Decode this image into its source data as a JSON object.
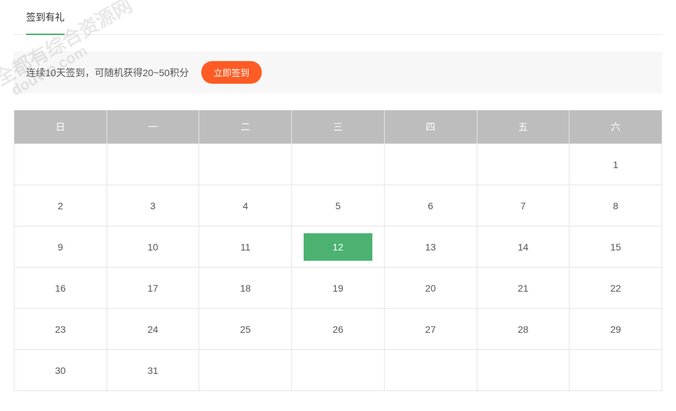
{
  "tabs": [
    {
      "label": "签到有礼",
      "active": true
    }
  ],
  "info": {
    "text": "连续10天签到，可随机获得20~50积分",
    "button": "立即签到"
  },
  "calendar": {
    "headers": [
      "日",
      "一",
      "二",
      "三",
      "四",
      "五",
      "六"
    ],
    "today": 12,
    "weeks": [
      [
        "",
        "",
        "",
        "",
        "",
        "",
        "1"
      ],
      [
        "2",
        "3",
        "4",
        "5",
        "6",
        "7",
        "8"
      ],
      [
        "9",
        "10",
        "11",
        "12",
        "13",
        "14",
        "15"
      ],
      [
        "16",
        "17",
        "18",
        "19",
        "20",
        "21",
        "22"
      ],
      [
        "23",
        "24",
        "25",
        "26",
        "27",
        "28",
        "29"
      ],
      [
        "30",
        "31",
        "",
        "",
        "",
        "",
        ""
      ]
    ]
  },
  "watermark": {
    "line1": "全都有综合资源网",
    "line2": "douvip.com"
  }
}
